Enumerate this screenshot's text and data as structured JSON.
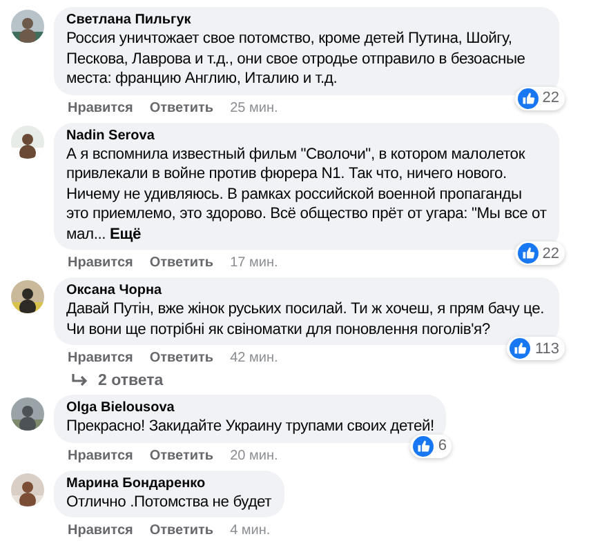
{
  "comments": [
    {
      "author": "Светлана Пильгук",
      "text": "Россия уничтожает свое потомство, кроме детей Путина, Шойгу, Пескова, Лаврова и т.д., они свое отродье отправило в безоасные места: францию Англию, Италию и т.д.",
      "like": "Нравится",
      "reply": "Ответить",
      "time": "25 мин.",
      "reactions": "22"
    },
    {
      "author": "Nadin Serova",
      "text": "А я вспомнила известный фильм \"Сволочи\", в котором малолеток привлекали в войне против фюрера N1. Так что, ничего нового. Ничему не удивляюсь. В рамках российской военной пропаганды это приемлемо, это здорово. Всё общество прёт от угара: \"Мы все от мал...",
      "more": "Ещё",
      "like": "Нравится",
      "reply": "Ответить",
      "time": "17 мин.",
      "reactions": "22"
    },
    {
      "author": "Оксана Чорна",
      "text": "Давай Путін, вже жінок руських посилай. Ти ж хочеш, я прям бачу це. Чи вони ще потрібні як свіноматки для поновлення поголів'я?",
      "like": "Нравится",
      "reply": "Ответить",
      "time": "42 мин.",
      "reactions": "113",
      "replies": "2 ответа"
    },
    {
      "author": "Olga Bielousova",
      "text": "Прекрасно! Закидайте Украину трупами своих детей!",
      "like": "Нравится",
      "reply": "Ответить",
      "time": "20 мин.",
      "reactions": "6"
    },
    {
      "author": "Марина Бондаренко",
      "text": "Отлично .Потомства не будет",
      "like": "Нравится",
      "reply": "Ответить",
      "time": "4 мин."
    }
  ]
}
